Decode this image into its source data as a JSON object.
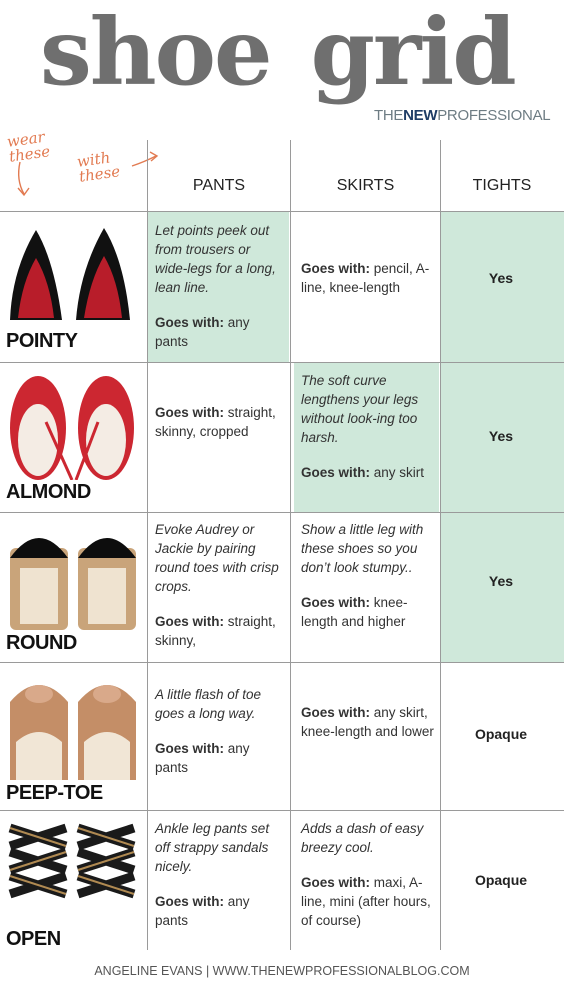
{
  "title": {
    "word1": "shoe",
    "word2": "grid"
  },
  "brand": {
    "part1": "THE",
    "part2": "NEW",
    "part3": "PROFESSIONAL"
  },
  "handwriting": {
    "wear": "wear",
    "these1": "these",
    "with": "with",
    "these2": "these"
  },
  "headers": {
    "pants": "PANTS",
    "skirts": "SKIRTS",
    "tights": "TIGHTS"
  },
  "rows": [
    {
      "label": "POINTY",
      "pants_italic": "Let points peek out from trousers or wide-legs for a long, lean line.",
      "pants_goes": "Goes with:",
      "pants_goes_text": " any pants",
      "skirts_italic": "",
      "skirts_goes": "Goes with:",
      "skirts_goes_text": " pencil, A-line, knee-length",
      "tights": "Yes"
    },
    {
      "label": "ALMOND",
      "pants_italic": "",
      "pants_goes": "Goes with:",
      "pants_goes_text": " straight, skinny, cropped",
      "skirts_italic": "The soft curve lengthens your legs without look-ing too harsh.",
      "skirts_goes": "Goes with:",
      "skirts_goes_text": " any skirt",
      "tights": "Yes"
    },
    {
      "label": "ROUND",
      "pants_italic": "Evoke Audrey or Jackie by pairing round toes with crisp crops.",
      "pants_goes": "Goes with:",
      "pants_goes_text": " straight, skinny,",
      "skirts_italic": "Show a little leg with these shoes so you don’t look stumpy..",
      "skirts_goes": "Goes with:",
      "skirts_goes_text": " knee-length and higher",
      "tights": "Yes"
    },
    {
      "label": "PEEP-TOE",
      "pants_italic": "A little flash of toe goes a long way.",
      "pants_goes": "Goes with:",
      "pants_goes_text": " any pants",
      "skirts_italic": "",
      "skirts_goes": "Goes with:",
      "skirts_goes_text": " any skirt, knee-length and lower",
      "tights": "Opaque"
    },
    {
      "label": "OPEN",
      "pants_italic": "Ankle leg pants set off strappy sandals nicely.",
      "pants_goes": "Goes with:",
      "pants_goes_text": " any pants",
      "skirts_italic": "Adds a dash of easy breezy cool.",
      "skirts_goes": "Goes with:",
      "skirts_goes_text": " maxi, A-line, mini (after hours, of course)",
      "tights": "Opaque"
    }
  ],
  "footer": "ANGELINE EVANS | WWW.THENEWPROFESSIONALBLOG.COM",
  "colors": {
    "green": "#cfe8da",
    "accent": "#e27b52",
    "brand": "#1f3d66"
  }
}
